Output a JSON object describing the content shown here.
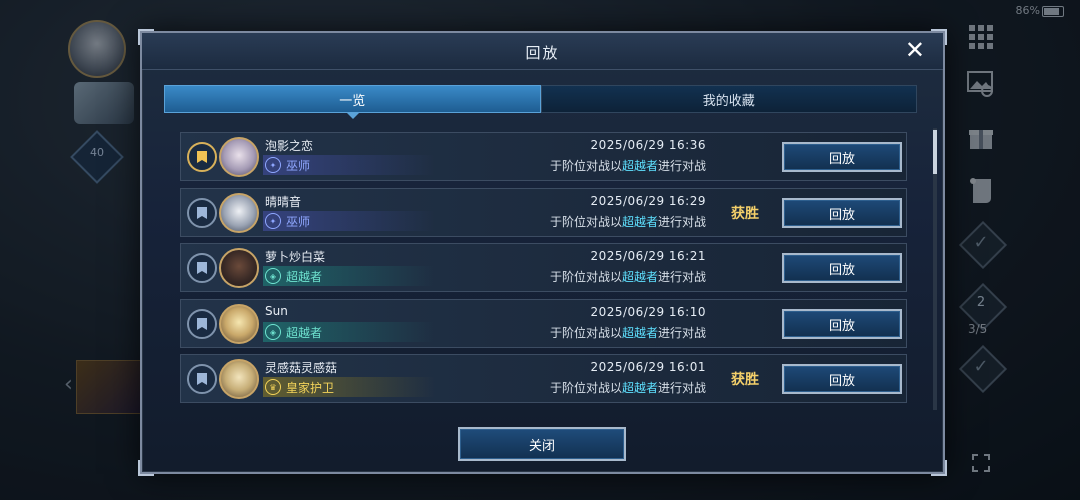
{
  "status": {
    "battery": "86%"
  },
  "background": {
    "level": "40",
    "quest_count": "3/5",
    "badge_num": "2"
  },
  "dialog": {
    "title": "回放",
    "close_label": "关闭",
    "tabs": [
      {
        "label": "一览",
        "active": true
      },
      {
        "label": "我的收藏",
        "active": false
      }
    ],
    "rows": [
      {
        "name": "泡影之恋",
        "class": "巫师",
        "class_color": "blue",
        "datetime": "2025/06/29  16:36",
        "desc_pre": "于阶位对战以",
        "desc_hl": "超越者",
        "desc_post": "进行对战",
        "result": "",
        "replay": "回放",
        "favorite": true
      },
      {
        "name": "晴晴音",
        "class": "巫师",
        "class_color": "blue",
        "datetime": "2025/06/29  16:29",
        "desc_pre": "于阶位对战以",
        "desc_hl": "超越者",
        "desc_post": "进行对战",
        "result": "获胜",
        "replay": "回放",
        "favorite": false
      },
      {
        "name": "萝卜炒白菜",
        "class": "超越者",
        "class_color": "teal",
        "datetime": "2025/06/29  16:21",
        "desc_pre": "于阶位对战以",
        "desc_hl": "超越者",
        "desc_post": "进行对战",
        "result": "",
        "replay": "回放",
        "favorite": false
      },
      {
        "name": "Sun",
        "class": "超越者",
        "class_color": "teal",
        "datetime": "2025/06/29  16:10",
        "desc_pre": "于阶位对战以",
        "desc_hl": "超越者",
        "desc_post": "进行对战",
        "result": "",
        "replay": "回放",
        "favorite": false
      },
      {
        "name": "灵感菇灵感菇",
        "class": "皇家护卫",
        "class_color": "gold",
        "datetime": "2025/06/29  16:01",
        "desc_pre": "于阶位对战以",
        "desc_hl": "超越者",
        "desc_post": "进行对战",
        "result": "获胜",
        "replay": "回放",
        "favorite": false
      }
    ]
  },
  "icons": {
    "close": "close-icon",
    "favorite": "bookmark-icon",
    "grid": "grid-menu-icon",
    "gallery": "image-icon",
    "gift": "gift-icon",
    "scroll": "scroll-icon",
    "fullscreen": "fullscreen-icon"
  }
}
